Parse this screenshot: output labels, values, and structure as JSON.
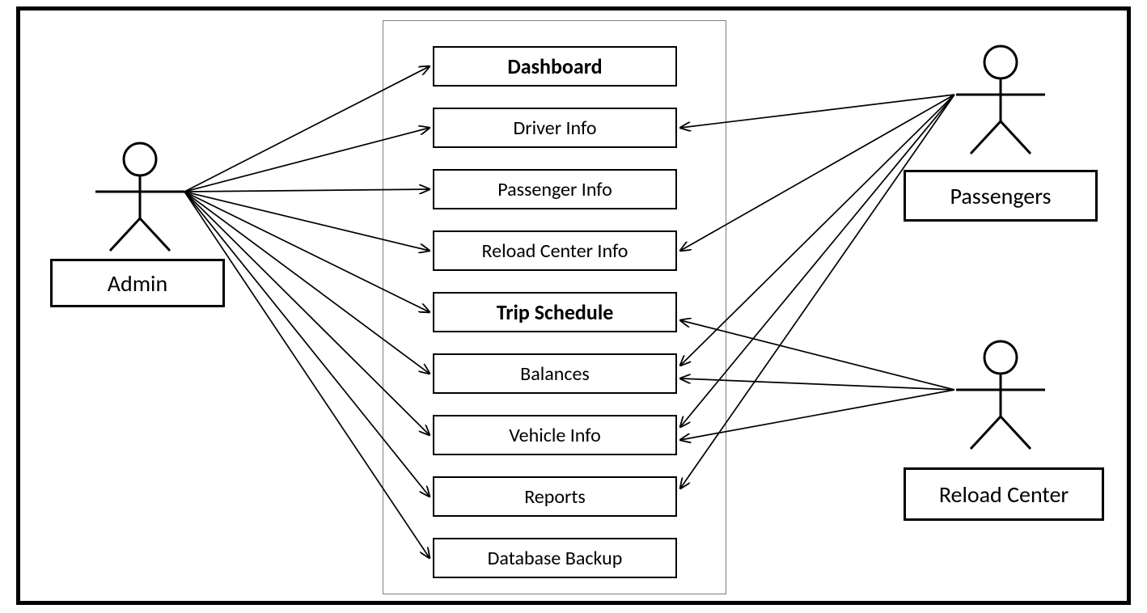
{
  "diagram": {
    "type": "use-case",
    "actors": {
      "admin": {
        "label": "Admin"
      },
      "passengers": {
        "label": "Passengers"
      },
      "reloadCenter": {
        "label": "Reload Center"
      }
    },
    "usecases": {
      "dashboard": {
        "label": "Dashboard"
      },
      "driverInfo": {
        "label": "Driver Info"
      },
      "passengerInfo": {
        "label": "Passenger Info"
      },
      "reloadInfo": {
        "label": "Reload Center Info"
      },
      "tripSchedule": {
        "label": "Trip Schedule"
      },
      "balances": {
        "label": "Balances"
      },
      "vehicleInfo": {
        "label": "Vehicle Info"
      },
      "reports": {
        "label": "Reports"
      },
      "dbBackup": {
        "label": "Database Backup"
      }
    }
  }
}
